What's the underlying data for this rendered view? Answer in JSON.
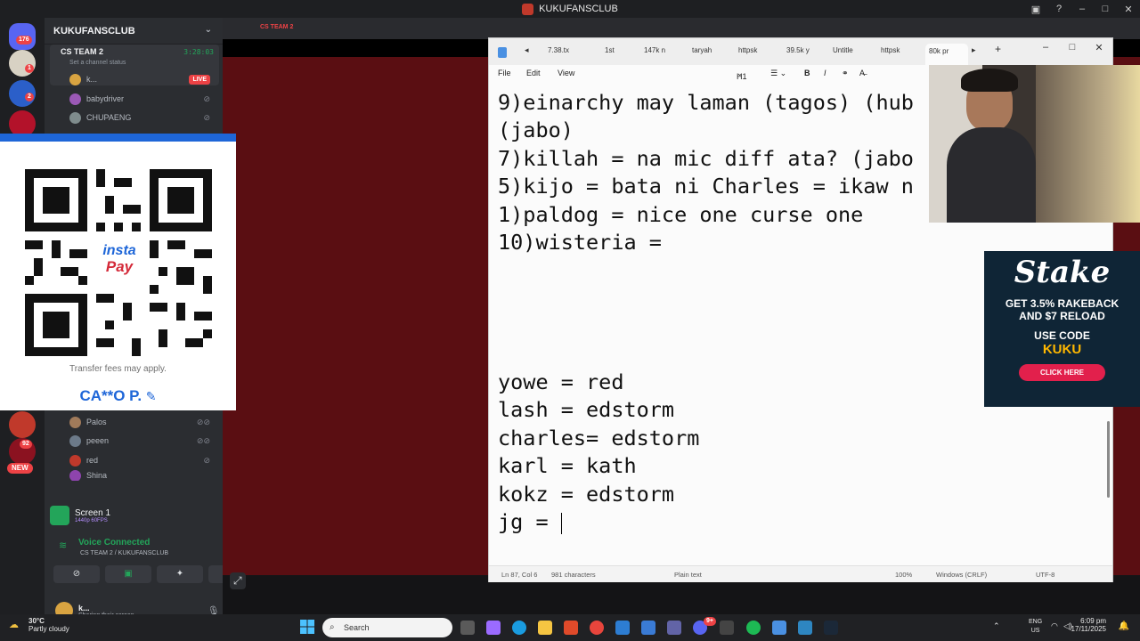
{
  "os": {
    "window_title": "KUKUFANSCLUB"
  },
  "discord": {
    "server_badges": [
      "176",
      "1",
      "2",
      "92"
    ],
    "new_badge": "NEW",
    "server_name": "KUKUFANSCLUB",
    "voice_channel": {
      "name": "CS TEAM 2",
      "timer": "3:28:03",
      "status_placeholder": "Set a channel status"
    },
    "voice_users": [
      {
        "name": "k...",
        "live": "LIVE",
        "avatar_color": "#d9a441"
      },
      {
        "name": "babydriver",
        "avatar_color": "#9b59b6"
      },
      {
        "name": "CHUPAENG",
        "avatar_color": "#7f8c8d"
      },
      {
        "name": "Palos",
        "avatar_color": "#a07a5a"
      },
      {
        "name": "peeen",
        "avatar_color": "#6c7a89"
      },
      {
        "name": "red",
        "avatar_color": "#c0392b"
      },
      {
        "name": "Shina",
        "avatar_color": "#8e44ad"
      }
    ],
    "screen": {
      "title": "Screen 1",
      "quality": "1440p 60FPS"
    },
    "voice_connected": {
      "label": "Voice Connected",
      "channel": "CS TEAM 2 / KUKUFANSCLUB"
    },
    "user": {
      "name": "k...",
      "status": "Sharing their screen"
    },
    "stream_channel_label": "CS TEAM 2"
  },
  "qr_overlay": {
    "logo_line1": "insta",
    "logo_line2": "Pay",
    "fee_note": "Transfer fees may apply.",
    "account_name": "CA**O P."
  },
  "notepad": {
    "tabs": [
      "7.38.tx",
      "1st",
      "147k n",
      "taryah",
      "httpsk",
      "39.5k y",
      "Untitle",
      "httpsk",
      "80k pr"
    ],
    "menu": {
      "file": "File",
      "edit": "Edit",
      "view": "View",
      "heading": "H1"
    },
    "lines": [
      "9)einarchy may laman (tagos) (hub",
      "(jabo)",
      "7)killah = na mic diff ata? (jabo",
      "5)kijo = bata ni Charles = ikaw n",
      "1)paldog = nice one curse one",
      "10)wisteria =",
      "",
      "",
      "",
      "",
      "yowe = red",
      "lash = edstorm",
      "charles= edstorm",
      "karl = kath",
      "kokz = edstorm",
      "jg = "
    ],
    "status": {
      "position": "Ln 87, Col 6",
      "chars": "981 characters",
      "format": "Plain text",
      "zoom": "100%",
      "eol": "Windows (CRLF)",
      "encoding": "UTF-8"
    }
  },
  "stake_ad": {
    "logo": "Stake",
    "promo_line1": "GET 3.5% RAKEBACK",
    "promo_line2": "AND $7 RELOAD",
    "use_code": "USE CODE",
    "code": "KUKU",
    "cta": "CLICK HERE"
  },
  "taskbar": {
    "weather_temp": "30°C",
    "weather_desc": "Partly cloudy",
    "search": "Search",
    "lang1": "ENG",
    "lang2": "US",
    "time": "6:09 pm",
    "date": "17/11/2025",
    "notif_badge": "9+"
  }
}
